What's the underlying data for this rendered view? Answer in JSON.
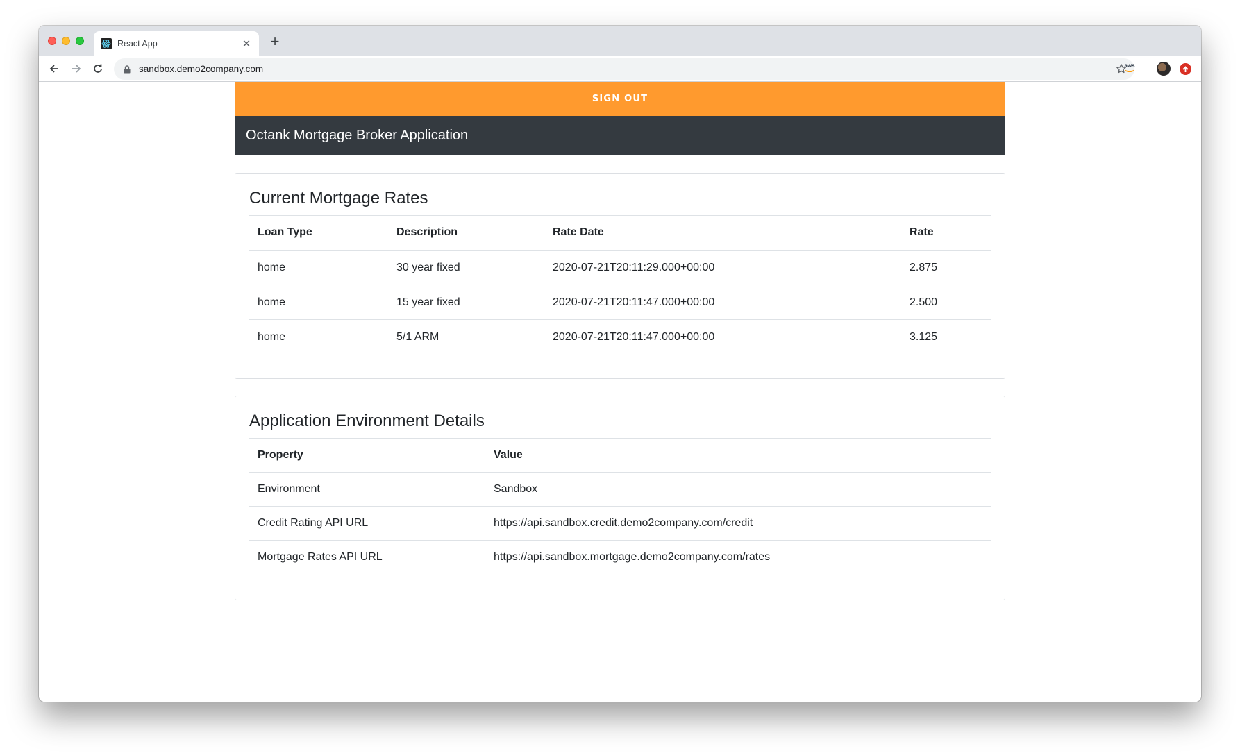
{
  "browser": {
    "tab_title": "React App",
    "url": "sandbox.demo2company.com",
    "amazon_extension_label": "aws"
  },
  "app": {
    "sign_out_label": "SIGN OUT",
    "navbar_title": "Octank Mortgage Broker Application"
  },
  "rates": {
    "title": "Current Mortgage Rates",
    "columns": [
      "Loan Type",
      "Description",
      "Rate Date",
      "Rate"
    ],
    "rows": [
      [
        "home",
        "30 year fixed",
        "2020-07-21T20:11:29.000+00:00",
        "2.875"
      ],
      [
        "home",
        "15 year fixed",
        "2020-07-21T20:11:47.000+00:00",
        "2.500"
      ],
      [
        "home",
        "5/1 ARM",
        "2020-07-21T20:11:47.000+00:00",
        "3.125"
      ]
    ]
  },
  "environment": {
    "title": "Application Environment Details",
    "columns": [
      "Property",
      "Value"
    ],
    "rows": [
      [
        "Environment",
        "Sandbox"
      ],
      [
        "Credit Rating API URL",
        "https://api.sandbox.credit.demo2company.com/credit"
      ],
      [
        "Mortgage Rates API URL",
        "https://api.sandbox.mortgage.demo2company.com/rates"
      ]
    ]
  },
  "colors": {
    "sign_out_bg": "#ff9a2e",
    "navbar_bg": "#343a40",
    "react_icon": "#61dafb"
  },
  "icons": {
    "favicon": "react-icon",
    "back": "arrow-left-icon",
    "forward": "arrow-right-icon",
    "reload": "reload-icon",
    "lock": "lock-icon",
    "bookmark": "star-icon",
    "update": "update-arrow-icon"
  }
}
